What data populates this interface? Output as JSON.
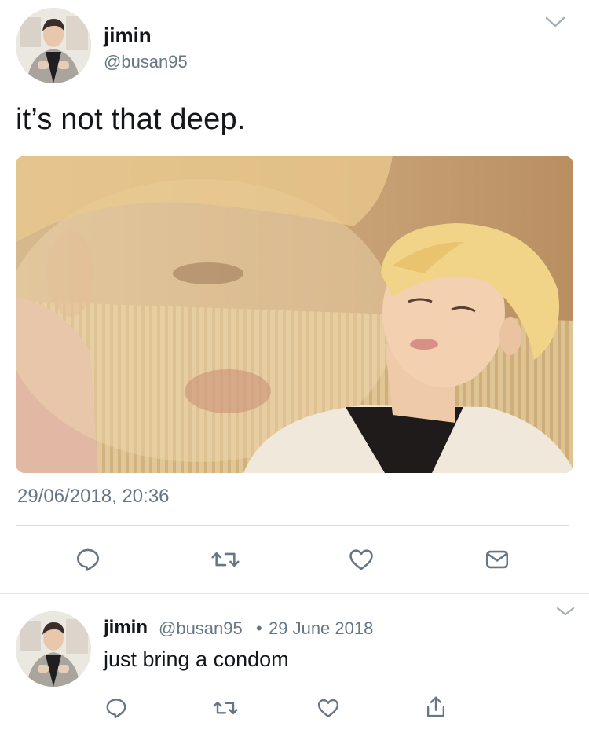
{
  "main_tweet": {
    "author_name": "jimin",
    "author_handle": "@busan95",
    "text": "it’s not that deep.",
    "timestamp": "29/06/2018, 20:36",
    "actions": [
      "reply-icon",
      "retweet-icon",
      "like-icon",
      "direct-message-icon"
    ]
  },
  "reply_tweet": {
    "author_name": "jimin",
    "author_handle": "@busan95",
    "separator": "•",
    "date": "29 June 2018",
    "text": "just bring a condom",
    "actions": [
      "reply-icon",
      "retweet-icon",
      "like-icon",
      "share-icon"
    ]
  },
  "colors": {
    "text_primary": "#14171a",
    "text_secondary": "#657786",
    "icon": "#657786",
    "divider": "#d6dbe0"
  }
}
